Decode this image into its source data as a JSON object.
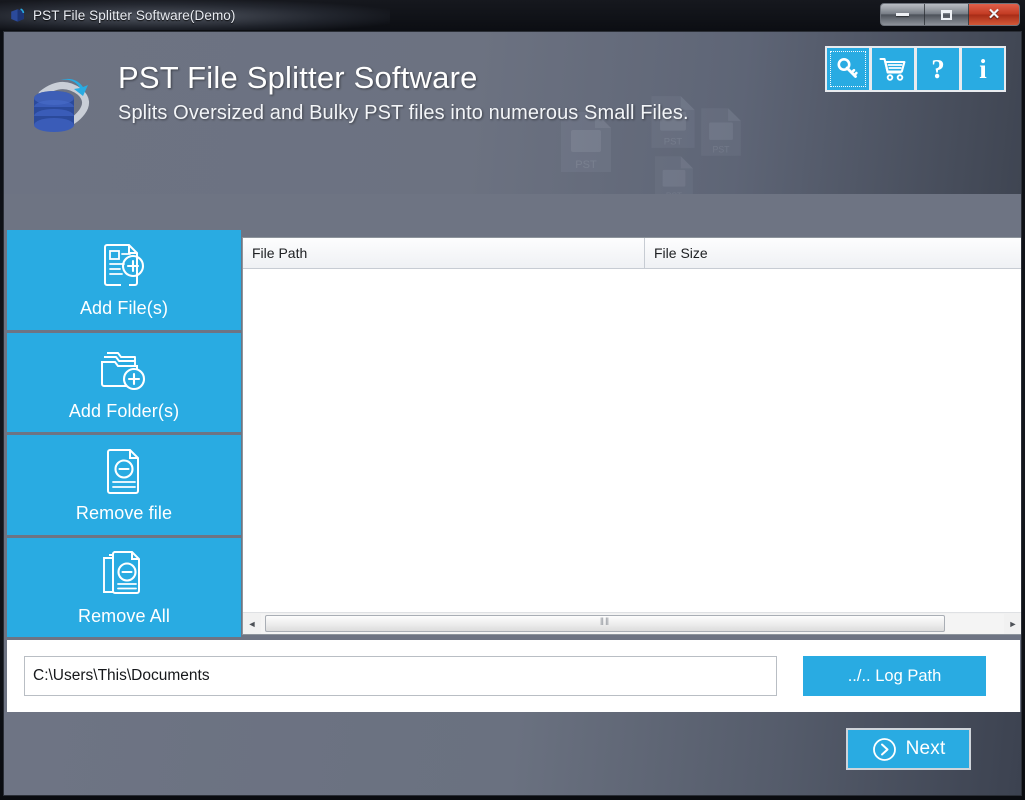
{
  "window": {
    "title": "PST File Splitter Software(Demo)",
    "app_icon": "pst-box-icon",
    "controls": [
      {
        "name": "minimize-button",
        "icon": "minimize-icon",
        "label": "—"
      },
      {
        "name": "maximize-button",
        "icon": "maximize-icon",
        "label": "□"
      },
      {
        "name": "close-button",
        "icon": "close-icon",
        "label": "✕"
      }
    ]
  },
  "banner": {
    "logo_icon": "database-refresh-icon",
    "title": "PST File Splitter Software",
    "subtitle": "Splits Oversized and Bulky PST files into numerous Small Files.",
    "watermark_icon": "pst-file-icon"
  },
  "toolbar": {
    "buttons": [
      {
        "name": "activate-key-button",
        "icon": "key-icon",
        "glyph": "⚿",
        "focused": true
      },
      {
        "name": "buy-now-button",
        "icon": "shopping-cart-icon",
        "glyph": "🛒",
        "focused": false
      },
      {
        "name": "help-button",
        "icon": "question-mark-icon",
        "glyph": "?",
        "focused": false
      },
      {
        "name": "about-info-button",
        "icon": "info-icon",
        "glyph": "i",
        "focused": false
      }
    ]
  },
  "sidebar": {
    "items": [
      {
        "name": "add-files-button",
        "label": "Add File(s)",
        "icon": "file-plus-icon"
      },
      {
        "name": "add-folders-button",
        "label": "Add Folder(s)",
        "icon": "folder-plus-icon"
      },
      {
        "name": "remove-file-button",
        "label": "Remove file",
        "icon": "file-minus-icon"
      },
      {
        "name": "remove-all-button",
        "label": "Remove All",
        "icon": "files-minus-icon"
      }
    ]
  },
  "file_list": {
    "columns": [
      {
        "name": "column-file-path",
        "label": "File Path"
      },
      {
        "name": "column-file-size",
        "label": "File Size"
      }
    ],
    "rows": [],
    "scrollbar": {
      "left_arrow": "◄",
      "right_arrow": "►",
      "grip": "‖‖"
    }
  },
  "path_row": {
    "input_value": "C:\\Users\\This\\Documents",
    "input_placeholder": "C:\\Users\\This\\Documents",
    "log_path_label": "../.. Log Path"
  },
  "footer": {
    "next_label": "Next",
    "next_icon": "chevron-right-circle-icon"
  },
  "colors": {
    "accent_blue": "#29abe2",
    "banner_slate": "#6d7383",
    "banner_slate_dark": "#3f4552",
    "close_red": "#c23b23",
    "panel_white": "#ffffff"
  }
}
